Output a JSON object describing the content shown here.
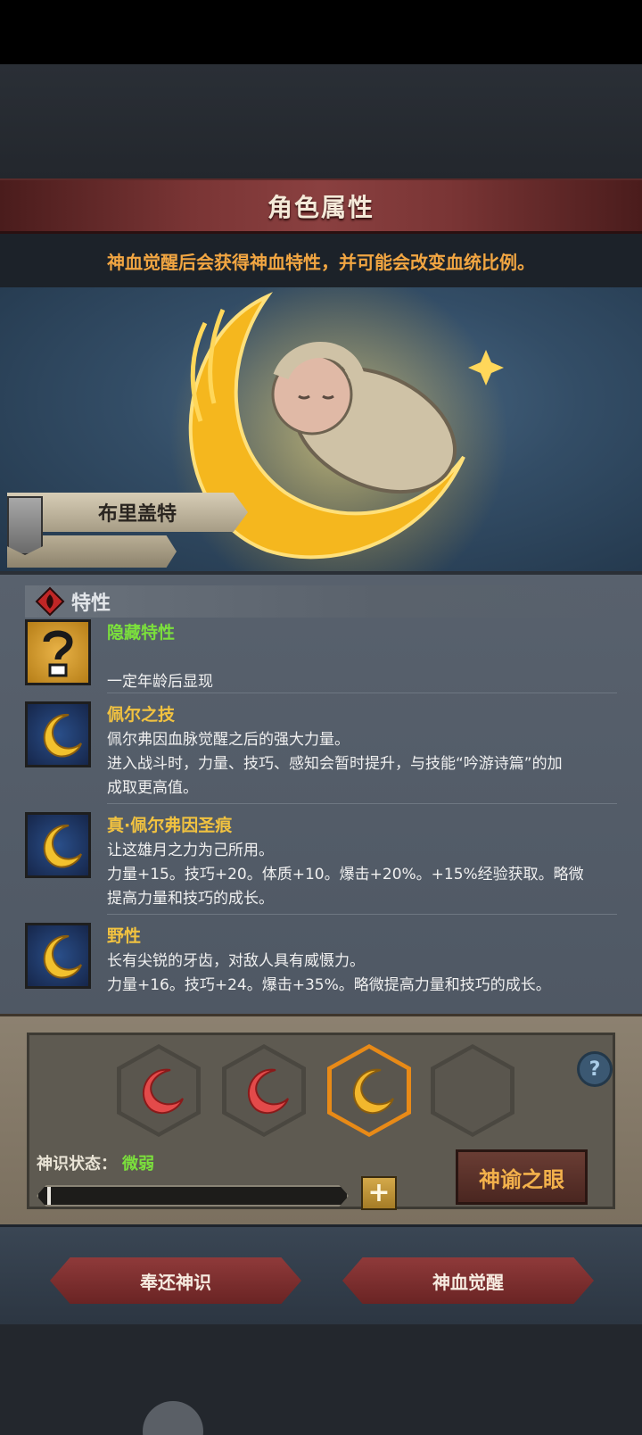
{
  "header": {
    "title": "角色属性"
  },
  "subtitle": "神血觉醒后会获得神血特性，并可能会改变血统比例。",
  "character": {
    "name": "布里盖特"
  },
  "traits_section": {
    "title": "特性",
    "items": [
      {
        "name": "隐藏特性",
        "icon": "question-icon",
        "lines": [
          "",
          "一定年龄后显现"
        ]
      },
      {
        "name": "佩尔之技",
        "icon": "crescent-moon-icon",
        "lines": [
          "佩尔弗因血脉觉醒之后的强大力量。",
          "进入战斗时，力量、技巧、感知会暂时提升，与技能“吟游诗篇”的加",
          "成取更高值。"
        ]
      },
      {
        "name": "真·佩尔弗因圣痕",
        "icon": "crescent-moon-icon",
        "lines": [
          "让这雄月之力为己所用。",
          "力量+15。技巧+20。体质+10。爆击+20%。+15%经验获取。略微",
          "提高力量和技巧的成长。"
        ]
      },
      {
        "name": "野性",
        "icon": "crescent-moon-icon",
        "lines": [
          "长有尖锐的牙齿，对敌人具有威慑力。",
          "力量+16。技巧+24。爆击+35%。略微提高力量和技巧的成长。"
        ]
      }
    ]
  },
  "awakening": {
    "status_label": "神识状态：",
    "status_value": "微弱",
    "progress": 0.0,
    "oracle_button": "神谕之眼",
    "plus_label": "+",
    "help_label": "?"
  },
  "actions": {
    "return_label": "奉还神识",
    "awaken_label": "神血觉醒"
  },
  "colors": {
    "accent_red": "#7a3535",
    "gold": "#f1c240",
    "green": "#7be03c",
    "orange": "#f2a642"
  }
}
